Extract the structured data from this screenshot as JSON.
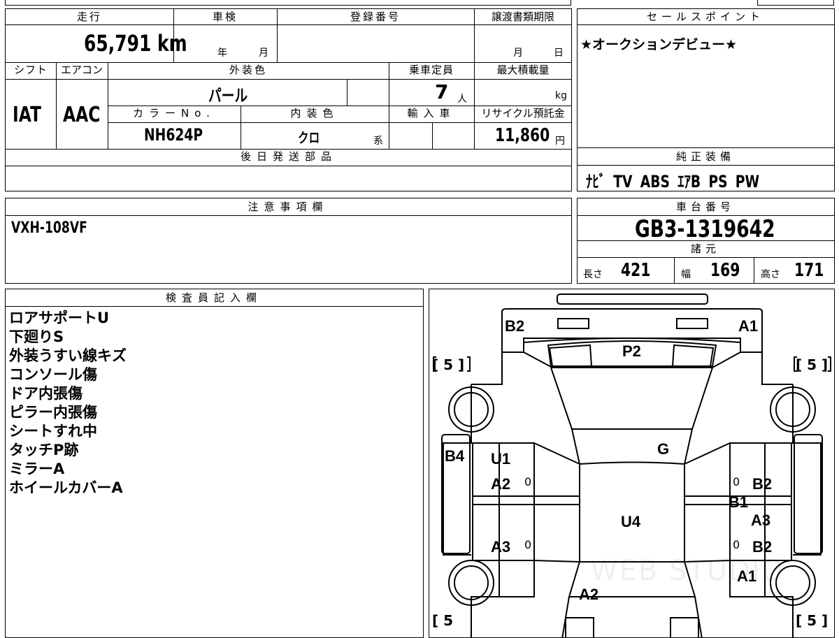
{
  "top_row": {
    "mileage_label": "走行",
    "mileage_value": "65,791 km",
    "inspection_label": "車検",
    "inspection_year": "年",
    "inspection_month": "月",
    "reg_label": "登録番号",
    "transfer_label": "譲渡書類期限",
    "transfer_month": "月",
    "transfer_day": "日"
  },
  "row2": {
    "shift_label": "シフト",
    "shift_value": "IAT",
    "ac_label": "エアコン",
    "ac_value": "AAC",
    "exterior_label": "外装色",
    "exterior_value": "パール",
    "capacity_label": "乗車定員",
    "capacity_value": "7",
    "capacity_unit": "人",
    "maxload_label": "最大積載量",
    "maxload_unit": "kg",
    "color_no_label": "カラーNo.",
    "color_no_value": "NH624P",
    "interior_label": "内装色",
    "interior_value": "クロ",
    "interior_suffix": "系",
    "import_label": "輸入車",
    "recycle_label": "リサイクル預託金",
    "recycle_value": "11,860",
    "recycle_unit": "円"
  },
  "later_parts_label": "後日発送部品",
  "sales_point": {
    "label": "セールスポイント",
    "text": "★オークションデビュー★"
  },
  "equipment": {
    "label": "純正装備",
    "items": "ﾅﾋﾞ TV ABS ｴｱB PS PW"
  },
  "notes": {
    "label": "注意事項欄",
    "text": "VXH-108VF"
  },
  "chassis": {
    "label": "車台番号",
    "value": "GB3-1319642",
    "spec_label": "諸元",
    "length_label": "長さ",
    "length_value": "421",
    "width_label": "幅",
    "width_value": "169",
    "height_label": "高さ",
    "height_value": "171"
  },
  "inspector": {
    "label": "検査員記入欄",
    "lines": [
      "ロアサポートU",
      "下廻りS",
      "外装うすい線キズ",
      "コンソール傷",
      "ドア内張傷",
      "ピラー内張傷",
      "シートすれ中",
      "タッチP跡",
      "ミラーA",
      "ホイールカバーA"
    ]
  },
  "diagram": {
    "marks": {
      "b2_rear_left": "B2",
      "a1_rear_right": "A1",
      "p2": "P2",
      "g": "G",
      "b4": "B4",
      "u1": "U1",
      "a2_left": "A2",
      "a3_left": "A3",
      "u4": "U4",
      "b2_right_upper": "B2",
      "b1": "B1",
      "a3_right": "A3",
      "b2_right_lower": "B2",
      "a1_right_lower": "A1",
      "a2_front": "A2"
    },
    "tire_left_top": "[ 5 ]",
    "tire_right_top": "[ 5 ]",
    "tire_left_bottom": "[ 5",
    "tire_right_bottom": "[ 5 ]",
    "zero_marks": [
      "0",
      "0",
      "0",
      "0"
    ],
    "watermark": "WEB STUDIO"
  }
}
